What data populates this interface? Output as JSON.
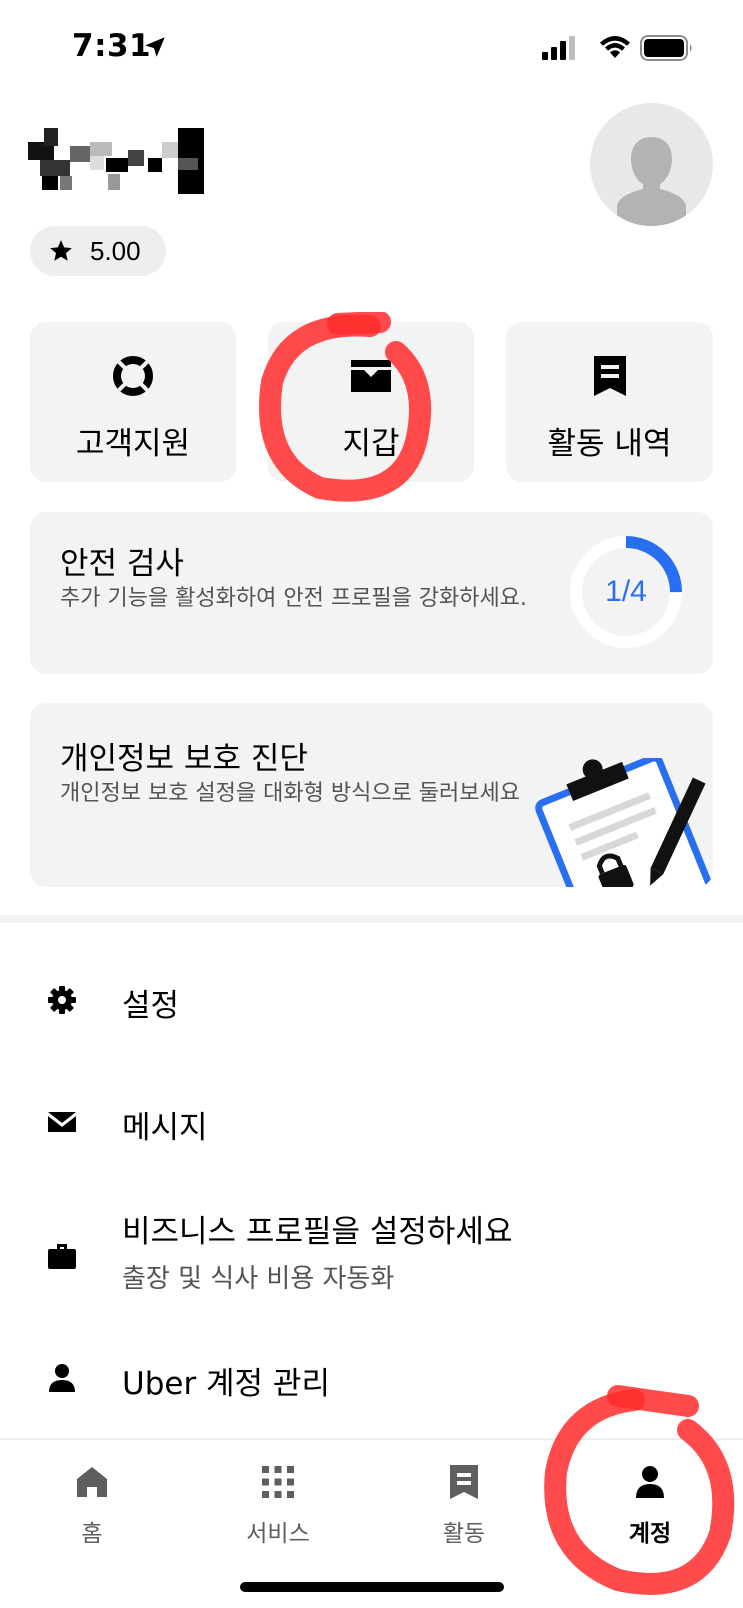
{
  "status_bar": {
    "time": "7:31"
  },
  "profile": {
    "rating": "5.00"
  },
  "tiles": [
    {
      "label": "고객지원",
      "icon": "lifebuoy-icon"
    },
    {
      "label": "지갑",
      "icon": "wallet-icon"
    },
    {
      "label": "활동 내역",
      "icon": "receipt-icon"
    }
  ],
  "safety_card": {
    "title": "안전 검사",
    "description": "추가 기능을 활성화하여 안전 프로필을 강화하세요.",
    "progress_label": "1/4",
    "progress": 0.25
  },
  "privacy_card": {
    "title": "개인정보 보호 진단",
    "description": "개인정보 보호 설정을 대화형 방식으로 둘러보세요"
  },
  "menu": {
    "settings": "설정",
    "messages": "메시지",
    "business_title": "비즈니스 프로필을 설정하세요",
    "business_sub": "출장 및 식사 비용 자동화",
    "account": "Uber 계정 관리"
  },
  "tabs": [
    {
      "label": "홈",
      "icon": "home-icon"
    },
    {
      "label": "서비스",
      "icon": "grid-icon"
    },
    {
      "label": "활동",
      "icon": "receipt-icon"
    },
    {
      "label": "계정",
      "icon": "person-icon",
      "active": true
    }
  ],
  "colors": {
    "accent": "#276ef1",
    "annotation": "#ff2b2b",
    "card_bg": "#f3f3f3"
  }
}
